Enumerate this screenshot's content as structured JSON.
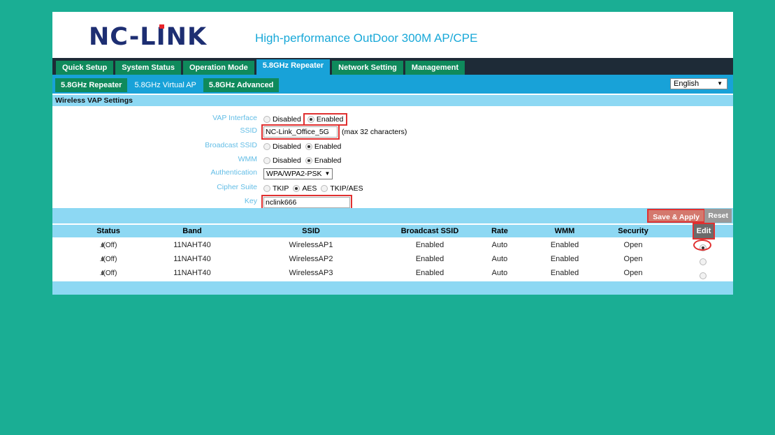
{
  "header": {
    "logo": "NC-LINK",
    "tagline": "High-performance OutDoor 300M AP/CPE"
  },
  "main_nav": [
    {
      "label": "Quick Setup"
    },
    {
      "label": "System Status"
    },
    {
      "label": "Operation Mode"
    },
    {
      "label": "5.8GHz Repeater",
      "active": true
    },
    {
      "label": "Network Setting"
    },
    {
      "label": "Management"
    }
  ],
  "sub_nav": [
    {
      "label": "5.8GHz Repeater"
    },
    {
      "label": "5.8GHz Virtual AP",
      "active": true
    },
    {
      "label": "5.8GHz Advanced"
    }
  ],
  "language": {
    "selected": "English"
  },
  "section_title": "Wireless VAP Settings",
  "form": {
    "vap_interface": {
      "label": "VAP Interface",
      "options": [
        "Disabled",
        "Enabled"
      ],
      "selected": "Enabled"
    },
    "ssid": {
      "label": "SSID",
      "value": "NC-Link_Office_5G",
      "hint": "(max 32 characters)"
    },
    "broadcast_ssid": {
      "label": "Broadcast SSID",
      "options": [
        "Disabled",
        "Enabled"
      ],
      "selected": "Enabled"
    },
    "wmm": {
      "label": "WMM",
      "options": [
        "Disabled",
        "Enabled"
      ],
      "selected": "Enabled"
    },
    "authentication": {
      "label": "Authentication",
      "selected": "WPA/WPA2-PSK"
    },
    "cipher_suite": {
      "label": "Cipher Suite",
      "options": [
        "TKIP",
        "AES",
        "TKIP/AES"
      ],
      "selected": "AES"
    },
    "key": {
      "label": "Key",
      "value": "nclink666"
    }
  },
  "actions": {
    "save_label": "Save & Apply",
    "reset_label": "Reset"
  },
  "table": {
    "headers": [
      "Status",
      "Band",
      "SSID",
      "Broadcast SSID",
      "Rate",
      "WMM",
      "Security",
      "Edit"
    ],
    "rows": [
      {
        "status": "(Off)",
        "band": "11NAHT40",
        "ssid": "WirelessAP1",
        "broadcast": "Enabled",
        "rate": "Auto",
        "wmm": "Enabled",
        "security": "Open",
        "edit_selected": true
      },
      {
        "status": "(Off)",
        "band": "11NAHT40",
        "ssid": "WirelessAP2",
        "broadcast": "Enabled",
        "rate": "Auto",
        "wmm": "Enabled",
        "security": "Open",
        "edit_selected": false
      },
      {
        "status": "(Off)",
        "band": "11NAHT40",
        "ssid": "WirelessAP3",
        "broadcast": "Enabled",
        "rate": "Auto",
        "wmm": "Enabled",
        "security": "Open",
        "edit_selected": false
      }
    ]
  },
  "colors": {
    "background": "#1aae94",
    "nav_dark": "#1e2b37",
    "tab_green": "#0f8a5c",
    "accent_blue": "#18a2d8",
    "light_blue": "#8dd8f3",
    "highlight_red": "#e03030"
  }
}
